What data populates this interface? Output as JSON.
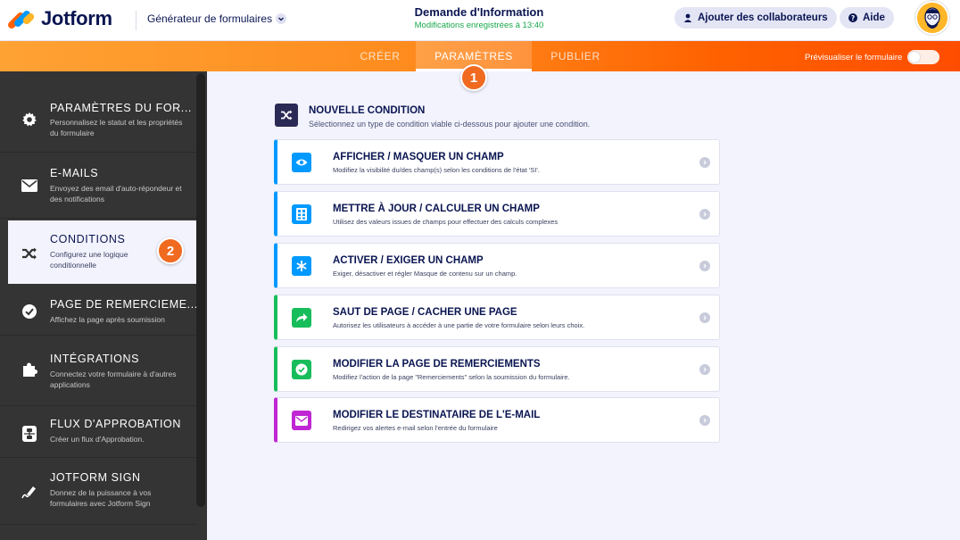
{
  "header": {
    "logo_text": "Jotform",
    "builder_label": "Générateur de formulaires",
    "form_title": "Demande d'Information",
    "save_status": "Modifications enregistrées à 13:40",
    "collab_button": "Ajouter des collaborateurs",
    "help_button": "Aide"
  },
  "nav": {
    "tabs": [
      {
        "label": "CRÉER"
      },
      {
        "label": "PARAMÈTRES"
      },
      {
        "label": "PUBLIER"
      }
    ],
    "preview_label": "Prévisualiser le formulaire",
    "preview_on": false
  },
  "callouts": [
    "1",
    "2"
  ],
  "sidebar": {
    "items": [
      {
        "title": "PARAMÈTRES DU FOR...",
        "desc": "Personnalisez le statut et les propriétés du formulaire",
        "icon": "gear-icon"
      },
      {
        "title": "E-MAILS",
        "desc": "Envoyez des email d'auto-répondeur et des notifications",
        "icon": "envelope-icon"
      },
      {
        "title": "CONDITIONS",
        "desc": "Configurez une logique conditionnelle",
        "icon": "shuffle-icon"
      },
      {
        "title": "PAGE DE REMERCIEME...",
        "desc": "Affichez la page après soumission",
        "icon": "check-circle-icon"
      },
      {
        "title": "INTÉGRATIONS",
        "desc": "Connectez votre formulaire à d'autres applications",
        "icon": "puzzle-icon"
      },
      {
        "title": "FLUX D'APPROBATION",
        "desc": "Créer un flux d'Approbation.",
        "icon": "approval-flow-icon"
      },
      {
        "title": "JOTFORM SIGN",
        "desc": "Donnez de la puissance à vos formulaires avec Jotform Sign",
        "icon": "pen-icon"
      }
    ]
  },
  "condition": {
    "title": "NOUVELLE CONDITION",
    "subtitle": "Sélectionnez un type de condition viable ci-dessous pour ajouter une condition.",
    "options": [
      {
        "title": "AFFICHER / MASQUER UN CHAMP",
        "desc": "Modifiez la visibilité du/des champ(s) selon les conditions de l'état 'SI'.",
        "icon": "eye-icon",
        "color": "#0099ff"
      },
      {
        "title": "METTRE À JOUR / CALCULER UN CHAMP",
        "desc": "Utilisez des valeurs issues de champs pour effectuer des calculs complexes",
        "icon": "calculator-icon",
        "color": "#0099ff"
      },
      {
        "title": "ACTIVER / EXIGER UN CHAMP",
        "desc": "Exiger, désactiver et régler Masque de contenu sur un champ.",
        "icon": "asterisk-icon",
        "color": "#0099ff"
      },
      {
        "title": "SAUT DE PAGE / CACHER UNE PAGE",
        "desc": "Autorisez les utilisateurs à accéder à une partie de votre formulaire selon leurs choix.",
        "icon": "forward-arrow-icon",
        "color": "#18bd5b"
      },
      {
        "title": "MODIFIER LA PAGE DE REMERCIEMENTS",
        "desc": "Modifiez l'action de la page \"Remerciements\" selon la soumission du formulaire.",
        "icon": "check-circle-icon",
        "color": "#18bd5b"
      },
      {
        "title": "MODIFIER LE DESTINATAIRE DE L'E-MAIL",
        "desc": "Redirigez vos alertes e-mail selon l'entrée du formulaire",
        "icon": "envelope-icon",
        "color": "#c026d3"
      }
    ]
  }
}
